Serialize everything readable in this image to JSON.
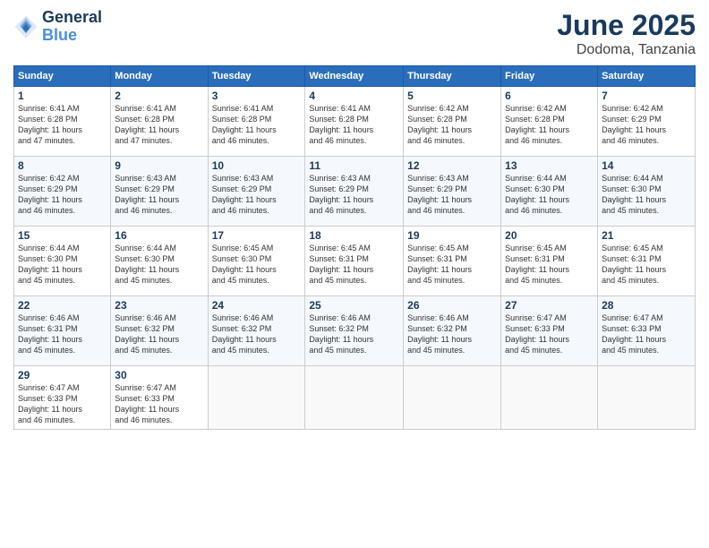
{
  "header": {
    "logo_line1": "General",
    "logo_line2": "Blue",
    "month": "June 2025",
    "location": "Dodoma, Tanzania"
  },
  "weekdays": [
    "Sunday",
    "Monday",
    "Tuesday",
    "Wednesday",
    "Thursday",
    "Friday",
    "Saturday"
  ],
  "weeks": [
    [
      {
        "day": "1",
        "info": "Sunrise: 6:41 AM\nSunset: 6:28 PM\nDaylight: 11 hours\nand 47 minutes."
      },
      {
        "day": "2",
        "info": "Sunrise: 6:41 AM\nSunset: 6:28 PM\nDaylight: 11 hours\nand 47 minutes."
      },
      {
        "day": "3",
        "info": "Sunrise: 6:41 AM\nSunset: 6:28 PM\nDaylight: 11 hours\nand 46 minutes."
      },
      {
        "day": "4",
        "info": "Sunrise: 6:41 AM\nSunset: 6:28 PM\nDaylight: 11 hours\nand 46 minutes."
      },
      {
        "day": "5",
        "info": "Sunrise: 6:42 AM\nSunset: 6:28 PM\nDaylight: 11 hours\nand 46 minutes."
      },
      {
        "day": "6",
        "info": "Sunrise: 6:42 AM\nSunset: 6:28 PM\nDaylight: 11 hours\nand 46 minutes."
      },
      {
        "day": "7",
        "info": "Sunrise: 6:42 AM\nSunset: 6:29 PM\nDaylight: 11 hours\nand 46 minutes."
      }
    ],
    [
      {
        "day": "8",
        "info": "Sunrise: 6:42 AM\nSunset: 6:29 PM\nDaylight: 11 hours\nand 46 minutes."
      },
      {
        "day": "9",
        "info": "Sunrise: 6:43 AM\nSunset: 6:29 PM\nDaylight: 11 hours\nand 46 minutes."
      },
      {
        "day": "10",
        "info": "Sunrise: 6:43 AM\nSunset: 6:29 PM\nDaylight: 11 hours\nand 46 minutes."
      },
      {
        "day": "11",
        "info": "Sunrise: 6:43 AM\nSunset: 6:29 PM\nDaylight: 11 hours\nand 46 minutes."
      },
      {
        "day": "12",
        "info": "Sunrise: 6:43 AM\nSunset: 6:29 PM\nDaylight: 11 hours\nand 46 minutes."
      },
      {
        "day": "13",
        "info": "Sunrise: 6:44 AM\nSunset: 6:30 PM\nDaylight: 11 hours\nand 46 minutes."
      },
      {
        "day": "14",
        "info": "Sunrise: 6:44 AM\nSunset: 6:30 PM\nDaylight: 11 hours\nand 45 minutes."
      }
    ],
    [
      {
        "day": "15",
        "info": "Sunrise: 6:44 AM\nSunset: 6:30 PM\nDaylight: 11 hours\nand 45 minutes."
      },
      {
        "day": "16",
        "info": "Sunrise: 6:44 AM\nSunset: 6:30 PM\nDaylight: 11 hours\nand 45 minutes."
      },
      {
        "day": "17",
        "info": "Sunrise: 6:45 AM\nSunset: 6:30 PM\nDaylight: 11 hours\nand 45 minutes."
      },
      {
        "day": "18",
        "info": "Sunrise: 6:45 AM\nSunset: 6:31 PM\nDaylight: 11 hours\nand 45 minutes."
      },
      {
        "day": "19",
        "info": "Sunrise: 6:45 AM\nSunset: 6:31 PM\nDaylight: 11 hours\nand 45 minutes."
      },
      {
        "day": "20",
        "info": "Sunrise: 6:45 AM\nSunset: 6:31 PM\nDaylight: 11 hours\nand 45 minutes."
      },
      {
        "day": "21",
        "info": "Sunrise: 6:45 AM\nSunset: 6:31 PM\nDaylight: 11 hours\nand 45 minutes."
      }
    ],
    [
      {
        "day": "22",
        "info": "Sunrise: 6:46 AM\nSunset: 6:31 PM\nDaylight: 11 hours\nand 45 minutes."
      },
      {
        "day": "23",
        "info": "Sunrise: 6:46 AM\nSunset: 6:32 PM\nDaylight: 11 hours\nand 45 minutes."
      },
      {
        "day": "24",
        "info": "Sunrise: 6:46 AM\nSunset: 6:32 PM\nDaylight: 11 hours\nand 45 minutes."
      },
      {
        "day": "25",
        "info": "Sunrise: 6:46 AM\nSunset: 6:32 PM\nDaylight: 11 hours\nand 45 minutes."
      },
      {
        "day": "26",
        "info": "Sunrise: 6:46 AM\nSunset: 6:32 PM\nDaylight: 11 hours\nand 45 minutes."
      },
      {
        "day": "27",
        "info": "Sunrise: 6:47 AM\nSunset: 6:33 PM\nDaylight: 11 hours\nand 45 minutes."
      },
      {
        "day": "28",
        "info": "Sunrise: 6:47 AM\nSunset: 6:33 PM\nDaylight: 11 hours\nand 45 minutes."
      }
    ],
    [
      {
        "day": "29",
        "info": "Sunrise: 6:47 AM\nSunset: 6:33 PM\nDaylight: 11 hours\nand 46 minutes."
      },
      {
        "day": "30",
        "info": "Sunrise: 6:47 AM\nSunset: 6:33 PM\nDaylight: 11 hours\nand 46 minutes."
      },
      {
        "day": "",
        "info": ""
      },
      {
        "day": "",
        "info": ""
      },
      {
        "day": "",
        "info": ""
      },
      {
        "day": "",
        "info": ""
      },
      {
        "day": "",
        "info": ""
      }
    ]
  ]
}
